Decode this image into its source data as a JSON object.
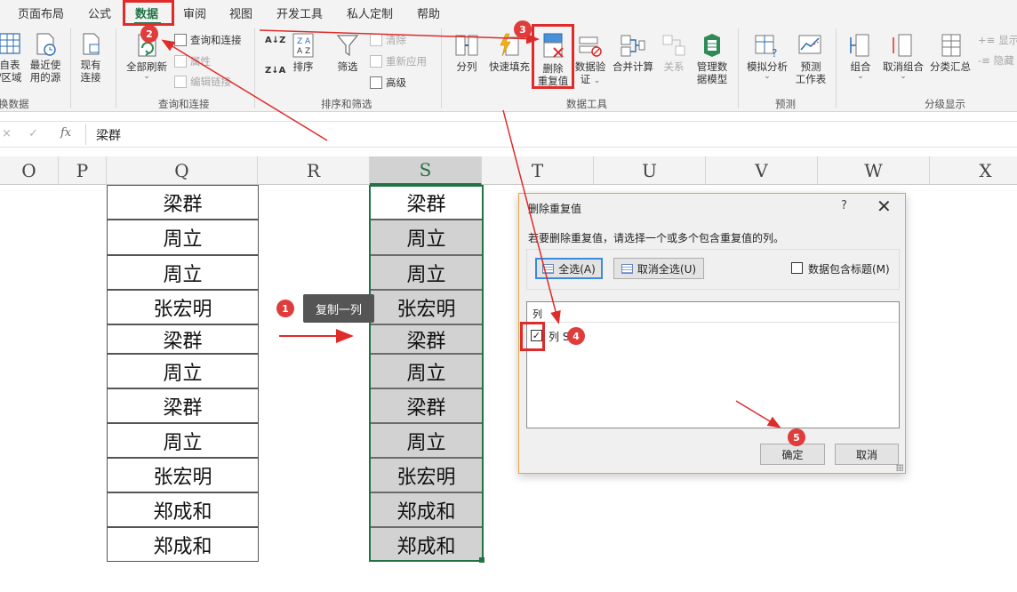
{
  "tabs": [
    "页面布局",
    "公式",
    "数据",
    "审阅",
    "视图",
    "开发工具",
    "私人定制",
    "帮助"
  ],
  "active_tab": "数据",
  "ribbon": {
    "groups": {
      "get_transform": "换数据",
      "queries": "查询和连接",
      "sort_filter": "排序和筛选",
      "data_tools": "数据工具",
      "forecast": "预测",
      "outline": "分级显示"
    },
    "buttons": {
      "from_table_1": "自表",
      "from_table_2": "/区域",
      "recent_sources_1": "最近使",
      "recent_sources_2": "用的源",
      "existing_connections_1": "现有",
      "existing_connections_2": "连接",
      "refresh_all": "全部刷新",
      "queries_connections": "查询和连接",
      "properties": "属性",
      "edit_links": "编辑链接",
      "sort": "排序",
      "filter": "筛选",
      "clear": "清除",
      "reapply": "重新应用",
      "advanced": "高级",
      "text_to_columns": "分列",
      "flash_fill": "快速填充",
      "remove_duplicates_1": "删除",
      "remove_duplicates_2": "重复值",
      "data_validation_1": "数据验",
      "data_validation_2": "证",
      "consolidate": "合并计算",
      "relationships": "关系",
      "manage_model_1": "管理数",
      "manage_model_2": "据模型",
      "what_if": "模拟分析",
      "forecast_sheet_1": "预测",
      "forecast_sheet_2": "工作表",
      "group": "组合",
      "ungroup": "取消组合",
      "subtotal": "分类汇总",
      "show_detail": "显示",
      "hide_detail": "隐藏"
    }
  },
  "formula_bar": {
    "cancel_glyph": "×",
    "enter_glyph": "✓",
    "fx_label": "fx",
    "value": "梁群"
  },
  "columns": [
    "O",
    "P",
    "Q",
    "R",
    "S",
    "T",
    "U",
    "V",
    "W",
    "X"
  ],
  "column_q": [
    "梁群",
    "周立",
    "周立",
    "张宏明",
    "梁群",
    "周立",
    "梁群",
    "周立",
    "张宏明",
    "郑成和",
    "郑成和"
  ],
  "column_s": [
    "梁群",
    "周立",
    "周立",
    "张宏明",
    "梁群",
    "周立",
    "梁群",
    "周立",
    "张宏明",
    "郑成和",
    "郑成和"
  ],
  "annotation": {
    "callout_text": "复制一列",
    "badges": [
      "1",
      "2",
      "3",
      "4",
      "5"
    ]
  },
  "dialog": {
    "title": "删除重复值",
    "help": "?",
    "close": "✕",
    "description": "若要删除重复值，请选择一个或多个包含重复值的列。",
    "select_all": "全选(A)",
    "unselect_all": "取消全选(U)",
    "has_headers": "数据包含标题(M)",
    "has_headers_checked": false,
    "list_header": "列",
    "columns_list": [
      {
        "label": "列 S",
        "checked": true
      }
    ],
    "ok": "确定",
    "cancel": "取消"
  },
  "colors": {
    "accent_green": "#217346",
    "annotation_red": "#e02b2b",
    "selected_fill": "#d2d2d2"
  }
}
